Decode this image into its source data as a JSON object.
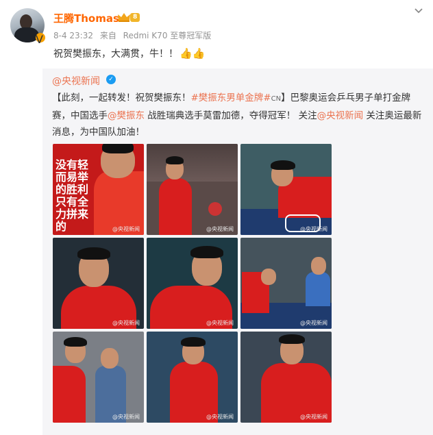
{
  "author": {
    "name": "王腾Thomas",
    "level_badge": "8",
    "verified_badge": "V"
  },
  "meta": {
    "date": "8-4 23:32",
    "source_prefix": "来自",
    "device": "Redmi K70 至尊冠军版"
  },
  "status": {
    "text": "祝贺樊振东，大满贯，牛！！",
    "emoji": "👍👍"
  },
  "repost": {
    "user": "@央视新闻",
    "text_parts": [
      {
        "t": "【此刻，一起转发！祝贺樊振东！",
        "hl": false
      },
      {
        "t": "#樊振东男单金牌#",
        "hl": true
      },
      {
        "t": "CN",
        "hl": false
      },
      {
        "t": "】巴黎奥运会乒乓男子单打金牌赛，中国选手",
        "hl": false
      },
      {
        "t": "@樊振东",
        "hl": true
      },
      {
        "t": " 战胜瑞典选手莫雷加德，夺得冠军！ 关注",
        "hl": false
      },
      {
        "t": "@央视新闻",
        "hl": true
      },
      {
        "t": " 关注奥运最新消息，为中国队加油！",
        "hl": false
      }
    ],
    "images": [
      {
        "name": "photo-1",
        "caption": "没有轻而易举的胜利 只有全力拼来的",
        "wm": "@央视新闻"
      },
      {
        "name": "photo-2",
        "caption": "",
        "wm": "@央视新闻"
      },
      {
        "name": "photo-3",
        "caption": "",
        "wm": "@央视新闻"
      },
      {
        "name": "photo-4",
        "caption": "",
        "wm": "@央视新闻"
      },
      {
        "name": "photo-5",
        "caption": "",
        "wm": "@央视新闻"
      },
      {
        "name": "photo-6",
        "caption": "",
        "wm": "@央视新闻"
      },
      {
        "name": "photo-7",
        "caption": "",
        "wm": "@央视新闻"
      },
      {
        "name": "photo-8",
        "caption": "",
        "wm": "@央视新闻"
      },
      {
        "name": "photo-9",
        "caption": "",
        "wm": "@央视新闻"
      }
    ]
  }
}
